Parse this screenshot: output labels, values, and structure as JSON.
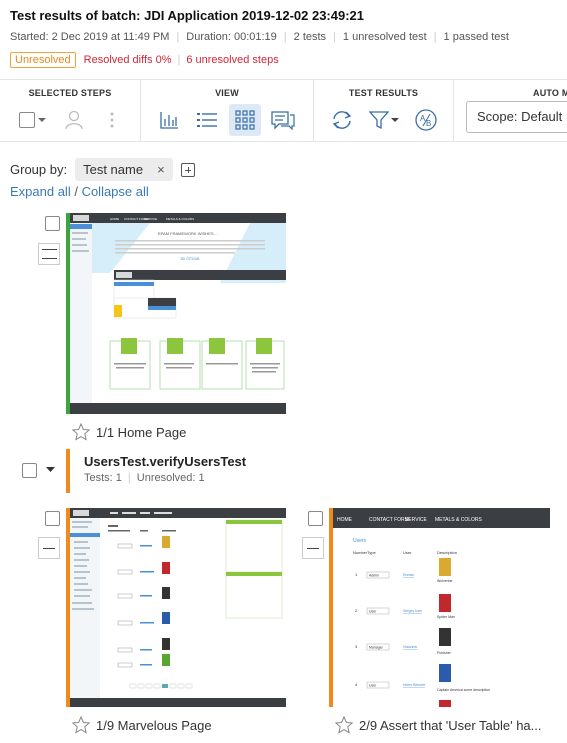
{
  "header": {
    "title": "Test results of batch:  JDI Application 2019-12-02 23:49:21",
    "started": "Started: 2 Dec 2019 at 11:49 PM",
    "duration": "Duration: 00:01:19",
    "tests": "2 tests",
    "unresolved_tests": "1 unresolved test",
    "passed_tests": "1 passed test",
    "status_badge": "Unresolved",
    "resolved_diffs": "Resolved diffs 0%",
    "unresolved_steps": "6 unresolved steps"
  },
  "toolbar": {
    "selected_steps_label": "SELECTED STEPS",
    "view_label": "VIEW",
    "test_results_label": "TEST RESULTS",
    "auto_label": "AUTO M",
    "scope_value": "Scope: Default"
  },
  "grouping": {
    "label": "Group by:",
    "chip": "Test name",
    "chip_remove": "×",
    "expand_all": "Expand all",
    "separator": " / ",
    "collapse_all": "Collapse all"
  },
  "steps": [
    {
      "caption": "1/1 Home Page",
      "status_color": "#3aa53a"
    },
    {
      "caption": "1/9 Marvelous Page",
      "status_color": "#ef8a1c"
    },
    {
      "caption": "2/9 Assert that 'User Table' ha...",
      "status_color": "#ef8a1c"
    }
  ],
  "group": {
    "name": "UsersTest.verifyUsersTest",
    "tests": "Tests: 1",
    "unresolved": "Unresolved: 1"
  },
  "thumb_home": {
    "nav": [
      "HOME",
      "CONTACT FORM",
      "SERVICE",
      "METALS & COLORS"
    ],
    "headline": "EPAM FRAMEWORK WISHES...",
    "link": "JDI GITHUB",
    "cards": [
      "To include good practices and ideas from successful EPAM project",
      "To be flexible and customizable",
      "To be multiplatform",
      "Already have good base (about 20 internal and some external projects), wish to get more..."
    ]
  },
  "thumb_users": {
    "nav": [
      "HOME",
      "CONTACT FORM",
      "SERVICE",
      "METALS & COLORS"
    ],
    "section": "Users",
    "columns": [
      "Number",
      "Type",
      "User",
      "Description"
    ],
    "rows": [
      {
        "n": "1",
        "type": "Admin",
        "user": "Roman",
        "desc": "Wolverine"
      },
      {
        "n": "2",
        "type": "User",
        "user": "Sergey Ivan",
        "desc": "Spider Man"
      },
      {
        "n": "3",
        "type": "Manager",
        "user": "Vladzimir",
        "desc": "Punisher"
      },
      {
        "n": "4",
        "type": "User",
        "user": "Helen Bennett",
        "desc": "Captain America some description"
      }
    ]
  }
}
